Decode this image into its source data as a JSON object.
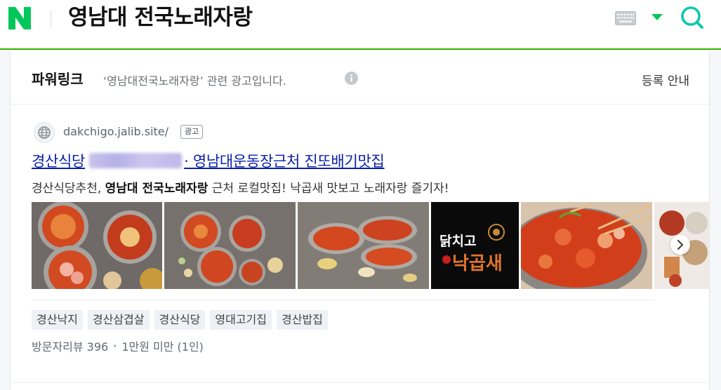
{
  "header": {
    "logo_letter": "N",
    "query": "영남대 전국노래자랑",
    "brand_color": "#03c75a"
  },
  "powerlink": {
    "title": "파워링크",
    "description": "‘영남대전국노래자랑’ 관련 광고입니다.",
    "register_label": "등록 안내"
  },
  "ad": {
    "url": "dakchigo.jalib.site/",
    "badge": "광고",
    "title_prefix": "경산식당",
    "title_suffix": "· 영남대운동장근처 진또배기맛집",
    "desc_before": "경산식당추천, ",
    "desc_bold": "영남대 전국노래자랑",
    "desc_after": " 근처 로컬맛집! 낙곱새 맛보고 노래자랑 즐기자!",
    "brand_image_text": [
      "닭치고",
      "낙곱새"
    ],
    "tags": [
      "경산낙지",
      "경산삼겹살",
      "경산식당",
      "영대고기집",
      "경산밥집"
    ],
    "review_label": "방문자리뷰 396",
    "price_label": "1만원 미만 (1인)"
  },
  "icons": {
    "keyboard": "keyboard-icon",
    "dropdown": "triangle-down-icon",
    "search": "search-icon",
    "info": "info-icon",
    "site": "globe-icon",
    "next": "chevron-right-icon"
  }
}
